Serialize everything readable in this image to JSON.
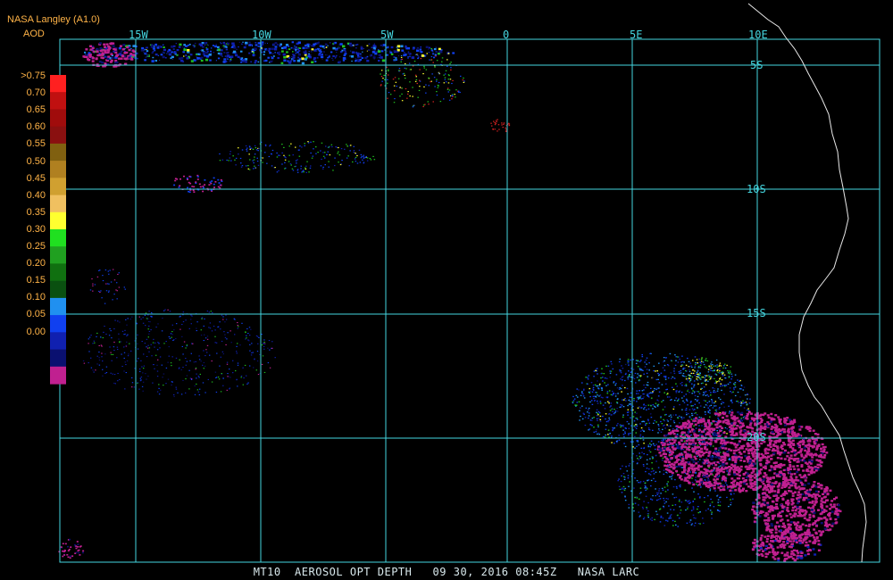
{
  "header": {
    "source": "NASA Langley (A1.0)",
    "product": "AOD"
  },
  "legend": {
    "labels": [
      ">0.75",
      "0.70",
      "0.65",
      "0.60",
      "0.55",
      "0.50",
      "0.45",
      "0.40",
      "0.35",
      "0.30",
      "0.25",
      "0.20",
      "0.15",
      "0.10",
      "0.05",
      "0.00"
    ],
    "colors": [
      "#ff2020",
      "#c01010",
      "#a00c0c",
      "#8a1010",
      "#806010",
      "#b08020",
      "#d0a030",
      "#f0c060",
      "#ffff30",
      "#20e020",
      "#20a020",
      "#107010",
      "#0a5010",
      "#2090f0",
      "#1040f0",
      "#1020b0",
      "#0a1070",
      "#c02090"
    ]
  },
  "map": {
    "lon_labels": [
      "15W",
      "10W",
      "5W",
      "0",
      "5E",
      "10E"
    ],
    "lat_labels": [
      "5S",
      "10S",
      "15S",
      "20S"
    ]
  },
  "footer": {
    "text": "MT10  AEROSOL OPT DEPTH   09 30, 2016 08:45Z   NASA LARC"
  }
}
